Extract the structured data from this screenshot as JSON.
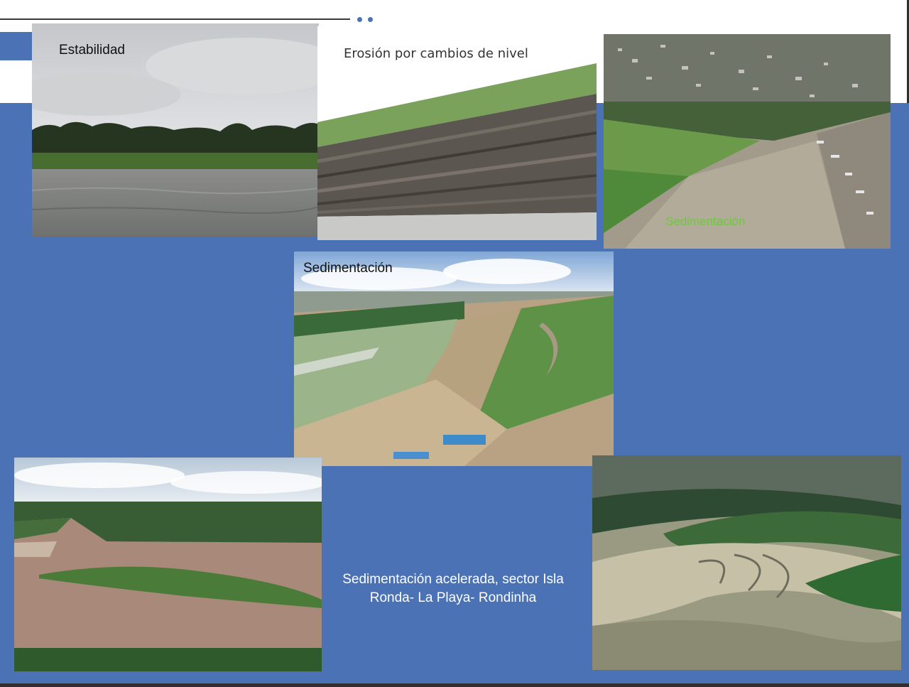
{
  "theme": {
    "panel_color": "#4a72b4",
    "dot_color": "#4a72b4"
  },
  "photos": [
    {
      "id": "estabilidad",
      "caption": "Estabilidad"
    },
    {
      "id": "erosion",
      "caption": "Erosión por cambios de nivel"
    },
    {
      "id": "sedimentacion-aerial-town",
      "caption": "Sedimentación"
    },
    {
      "id": "sedimentacion-aerial-river",
      "caption": "Sedimentación"
    },
    {
      "id": "isla-ronda",
      "caption": ""
    },
    {
      "id": "sandbanks",
      "caption": ""
    }
  ],
  "main_caption": "Sedimentación acelerada, sector Isla Ronda- La Playa- Rondinha"
}
